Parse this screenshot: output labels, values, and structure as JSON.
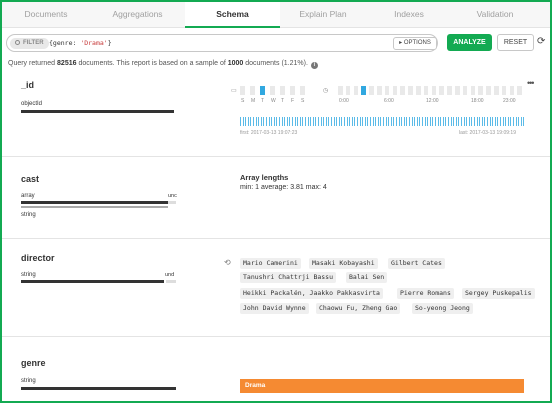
{
  "tabs": [
    {
      "label": "Documents",
      "active": false
    },
    {
      "label": "Aggregations",
      "active": false
    },
    {
      "label": "Schema",
      "active": true
    },
    {
      "label": "Explain Plan",
      "active": false
    },
    {
      "label": "Indexes",
      "active": false
    },
    {
      "label": "Validation",
      "active": false
    }
  ],
  "query": {
    "filter_label": "FILTER",
    "filter_key": "{genre: ",
    "filter_value": "'Drama'",
    "filter_close": "}",
    "options_label": "OPTIONS",
    "analyze_label": "ANALYZE",
    "reset_label": "RESET"
  },
  "summary": {
    "prefix": "Query returned ",
    "count": "82516",
    "middle": " documents. This report is based on a sample of ",
    "sample": "1000",
    "suffix": " documents (1.21%)."
  },
  "fields": {
    "id": {
      "name": "_id",
      "type": "objectId",
      "weekdays": [
        "S",
        "M",
        "T",
        "W",
        "T",
        "F",
        "S"
      ],
      "weekday_highlight": 2,
      "hours": [
        "0:00",
        "6:00",
        "12:00",
        "18:00",
        "23:00"
      ],
      "first": "first: 2017-03-13 19:07:23",
      "last": "last: 2017-03-13 19:09:19"
    },
    "cast": {
      "name": "cast",
      "type_primary": "array",
      "type_secondary": "string",
      "type_tail": "unc",
      "array_title": "Array lengths",
      "array_stats": "min: 1   average: 3.81   max: 4"
    },
    "director": {
      "name": "director",
      "type": "string",
      "type_tail": "und",
      "values": [
        "Mario Camerini",
        "Masaki Kobayashi",
        "Gilbert Cates",
        "Tanushri Chattrji Bassu",
        "Balai Sen",
        "Heikki Packalén, Jaakko Pakkasvirta",
        "Pierre Romans",
        "Sergey Puskepalis",
        "John David Wynne",
        "Chaowu Fu, Zheng Gao",
        "So-yeong Jeong"
      ]
    },
    "genre": {
      "name": "genre",
      "type": "string",
      "values": [
        "Drama"
      ]
    }
  },
  "colors": {
    "accent_green": "#13aa52",
    "objectid_blue": "#31a8e0",
    "genre_orange": "#f58a32"
  },
  "icons": {
    "filter": "filter-dot-icon",
    "options": "caret-right-icon",
    "refresh": "refresh-icon",
    "info": "info-icon",
    "more": "ellipsis-icon",
    "calendar": "calendar-icon",
    "clock": "clock-icon",
    "shuffle": "shuffle-icon"
  }
}
